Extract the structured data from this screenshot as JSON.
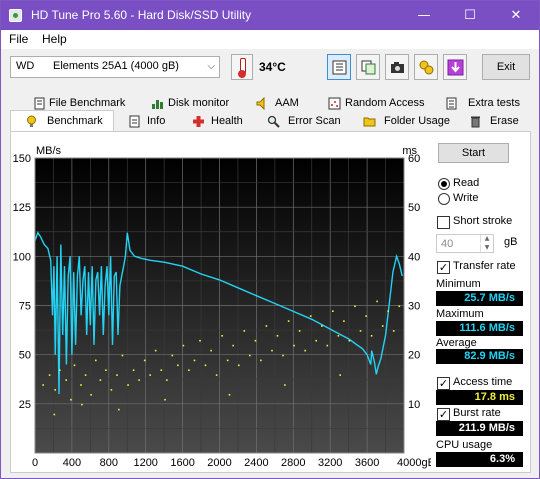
{
  "window": {
    "title": "HD Tune Pro 5.60 - Hard Disk/SSD Utility",
    "controls": {
      "minimize": "—",
      "maximize": "☐",
      "close": "✕"
    },
    "title_bar_color": "#7a4fc4"
  },
  "menu": {
    "file": "File",
    "help": "Help"
  },
  "toolbar": {
    "drive_prefix": "WD",
    "drive_name": "Elements 25A1 (4000 gB)",
    "temperature": "34°C",
    "exit_label": "Exit",
    "icons": [
      "info-icon",
      "copy-icon",
      "camera-icon",
      "save-icon",
      "download-icon"
    ]
  },
  "tabs": {
    "row1": [
      "File Benchmark",
      "Disk monitor",
      "AAM",
      "Random Access",
      "Extra tests"
    ],
    "row2": [
      "Benchmark",
      "Info",
      "Health",
      "Error Scan",
      "Folder Usage",
      "Erase"
    ],
    "active": "Benchmark"
  },
  "side": {
    "start_label": "Start",
    "read_label": "Read",
    "write_label": "Write",
    "mode": "Read",
    "short_stroke_label": "Short stroke",
    "short_stroke_checked": false,
    "short_stroke_value": "40",
    "short_stroke_unit": "gB",
    "transfer_rate_label": "Transfer rate",
    "transfer_rate_checked": true,
    "minimum_label": "Minimum",
    "minimum_value": "25.7 MB/s",
    "maximum_label": "Maximum",
    "maximum_value": "111.6 MB/s",
    "average_label": "Average",
    "average_value": "82.9 MB/s",
    "access_time_label": "Access time",
    "access_time_checked": true,
    "access_time_value": "17.8 ms",
    "burst_rate_label": "Burst rate",
    "burst_rate_checked": true,
    "burst_rate_value": "211.9 MB/s",
    "cpu_usage_label": "CPU usage",
    "cpu_usage_value": "6.3%",
    "rate_color": "#22d3f5",
    "access_color": "#f2f23a"
  },
  "chart_data": {
    "type": "line",
    "ylabel_left": "MB/s",
    "ylabel_right": "ms",
    "xlabel": "gB",
    "ylim_left": [
      0,
      150
    ],
    "ylim_right": [
      0,
      60
    ],
    "xlim": [
      0,
      4000
    ],
    "x_ticks": [
      "0",
      "400",
      "800",
      "1200",
      "1600",
      "2000",
      "2400",
      "2800",
      "3200",
      "3600",
      "4000gB"
    ],
    "y_left_ticks": [
      "25",
      "50",
      "75",
      "100",
      "125",
      "150"
    ],
    "y_right_ticks": [
      "10",
      "20",
      "30",
      "40",
      "50",
      "60"
    ],
    "grid": true,
    "series": [
      {
        "color": "#22d3f5",
        "points": [
          [
            0,
            108
          ],
          [
            30,
            112
          ],
          [
            60,
            110
          ],
          [
            100,
            106
          ],
          [
            140,
            104
          ],
          [
            170,
            98
          ],
          [
            190,
            70
          ],
          [
            205,
            95
          ],
          [
            220,
            50
          ],
          [
            240,
            100
          ],
          [
            260,
            30
          ],
          [
            280,
            106
          ],
          [
            300,
            60
          ],
          [
            320,
            95
          ],
          [
            340,
            45
          ],
          [
            360,
            90
          ],
          [
            380,
            100
          ],
          [
            400,
            50
          ],
          [
            420,
            92
          ],
          [
            440,
            55
          ],
          [
            460,
            90
          ],
          [
            480,
            100
          ],
          [
            500,
            70
          ],
          [
            520,
            88
          ],
          [
            540,
            95
          ],
          [
            560,
            60
          ],
          [
            580,
            92
          ],
          [
            600,
            65
          ],
          [
            620,
            95
          ],
          [
            640,
            55
          ],
          [
            660,
            88
          ],
          [
            680,
            92
          ],
          [
            700,
            70
          ],
          [
            720,
            95
          ],
          [
            740,
            60
          ],
          [
            760,
            85
          ],
          [
            780,
            95
          ],
          [
            800,
            70
          ],
          [
            820,
            100
          ],
          [
            840,
            55
          ],
          [
            860,
            90
          ],
          [
            880,
            92
          ],
          [
            900,
            60
          ],
          [
            920,
            85
          ],
          [
            940,
            90
          ],
          [
            960,
            95
          ],
          [
            980,
            100
          ],
          [
            1000,
            112
          ],
          [
            1030,
            103
          ],
          [
            1080,
            100
          ],
          [
            1150,
            99
          ],
          [
            1250,
            98
          ],
          [
            1400,
            97
          ],
          [
            1600,
            95
          ],
          [
            1800,
            91
          ],
          [
            2000,
            88
          ],
          [
            2200,
            84
          ],
          [
            2400,
            80
          ],
          [
            2600,
            76
          ],
          [
            2800,
            72
          ],
          [
            3000,
            68
          ],
          [
            3200,
            63
          ],
          [
            3400,
            58
          ],
          [
            3550,
            53
          ],
          [
            3600,
            50
          ],
          [
            3640,
            45
          ],
          [
            3650,
            52
          ],
          [
            3680,
            46
          ],
          [
            3700,
            40
          ],
          [
            3720,
            44
          ],
          [
            3750,
            48
          ],
          [
            3800,
            60
          ],
          [
            3850,
            80
          ],
          [
            3880,
            92
          ],
          [
            3920,
            100
          ],
          [
            3950,
            96
          ],
          [
            3980,
            90
          ]
        ]
      },
      {
        "color": "#f2f23a",
        "points": [
          [
            80,
            14
          ],
          [
            150,
            16
          ],
          [
            210,
            13
          ],
          [
            260,
            17
          ],
          [
            330,
            15
          ],
          [
            380,
            11
          ],
          [
            420,
            18
          ],
          [
            490,
            14
          ],
          [
            540,
            16
          ],
          [
            600,
            12
          ],
          [
            650,
            19
          ],
          [
            700,
            15
          ],
          [
            760,
            17
          ],
          [
            820,
            13
          ],
          [
            880,
            16
          ],
          [
            940,
            20
          ],
          [
            1000,
            14
          ],
          [
            1060,
            17
          ],
          [
            1120,
            15
          ],
          [
            1180,
            19
          ],
          [
            1240,
            16
          ],
          [
            1300,
            21
          ],
          [
            1360,
            17
          ],
          [
            1420,
            15
          ],
          [
            1480,
            20
          ],
          [
            1540,
            18
          ],
          [
            1600,
            22
          ],
          [
            1660,
            17
          ],
          [
            1720,
            19
          ],
          [
            1780,
            23
          ],
          [
            1840,
            18
          ],
          [
            1900,
            21
          ],
          [
            1960,
            16
          ],
          [
            2020,
            24
          ],
          [
            2080,
            19
          ],
          [
            2140,
            22
          ],
          [
            2200,
            18
          ],
          [
            2260,
            25
          ],
          [
            2320,
            20
          ],
          [
            2380,
            23
          ],
          [
            2440,
            19
          ],
          [
            2500,
            26
          ],
          [
            2560,
            21
          ],
          [
            2620,
            24
          ],
          [
            2680,
            20
          ],
          [
            2740,
            27
          ],
          [
            2800,
            22
          ],
          [
            2860,
            25
          ],
          [
            2920,
            21
          ],
          [
            2980,
            28
          ],
          [
            3040,
            23
          ],
          [
            3100,
            26
          ],
          [
            3160,
            22
          ],
          [
            3220,
            29
          ],
          [
            3280,
            24
          ],
          [
            3340,
            27
          ],
          [
            3400,
            23
          ],
          [
            3460,
            30
          ],
          [
            3520,
            25
          ],
          [
            3580,
            28
          ],
          [
            3640,
            24
          ],
          [
            3700,
            31
          ],
          [
            3760,
            26
          ],
          [
            3820,
            29
          ],
          [
            3880,
            25
          ],
          [
            3940,
            30
          ],
          [
            200,
            8
          ],
          [
            500,
            10
          ],
          [
            900,
            9
          ],
          [
            1400,
            11
          ],
          [
            2100,
            12
          ],
          [
            2700,
            14
          ],
          [
            3300,
            16
          ]
        ]
      }
    ]
  }
}
